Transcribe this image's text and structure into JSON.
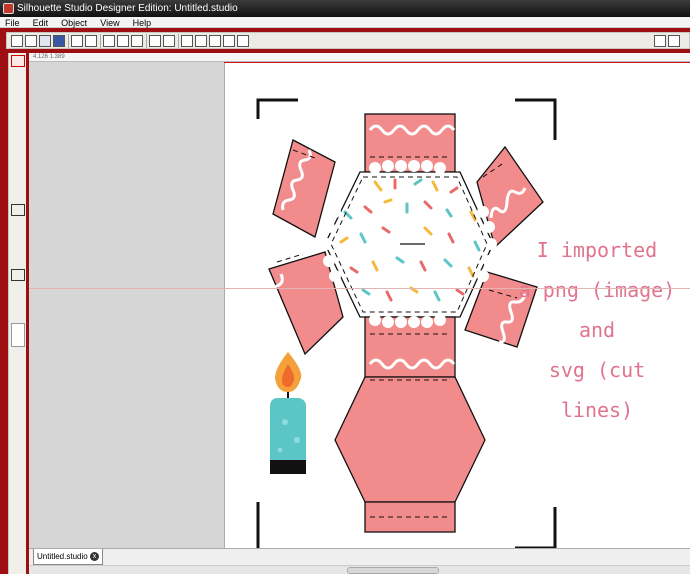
{
  "window": {
    "title": "Silhouette Studio Designer Edition: Untitled.studio"
  },
  "menu": [
    "File",
    "Edit",
    "Object",
    "View",
    "Help"
  ],
  "ruler": {
    "coord": "4.126  1.389"
  },
  "canvas_note": [
    "I imported",
    "a png (image)",
    "and",
    "svg (cut lines)"
  ],
  "tabs": [
    {
      "label": "Untitled.studio",
      "close": "x"
    }
  ],
  "colors": {
    "frame": "#9e0f14",
    "box_pink": "#f28b8b",
    "candle": "#5cc6c6",
    "note_pink": "#e0748e"
  },
  "icons": {
    "toolbar": [
      "new-icon",
      "open-icon",
      "save-icon",
      "save-as-icon",
      "print-icon",
      "print-cut-icon",
      "copy-icon",
      "paste-icon",
      "paste-in-front-icon",
      "undo-icon",
      "redo-icon",
      "zoom-in-icon",
      "zoom-out-icon",
      "zoom-box-icon",
      "pan-icon",
      "fit-page-icon",
      "edit-points-icon",
      "page-setup-icon"
    ],
    "tools": [
      "select-icon",
      "point-edit-icon",
      "line-icon",
      "polygon-icon",
      "rectangle-icon",
      "rounded-rect-icon",
      "ellipse-icon",
      "curve-icon",
      "arc-icon",
      "freehand-icon",
      "text-icon",
      "eraser-icon",
      "knife-icon",
      "fill-icon",
      "library-icon",
      "store-icon",
      "cut-settings-icon"
    ]
  }
}
